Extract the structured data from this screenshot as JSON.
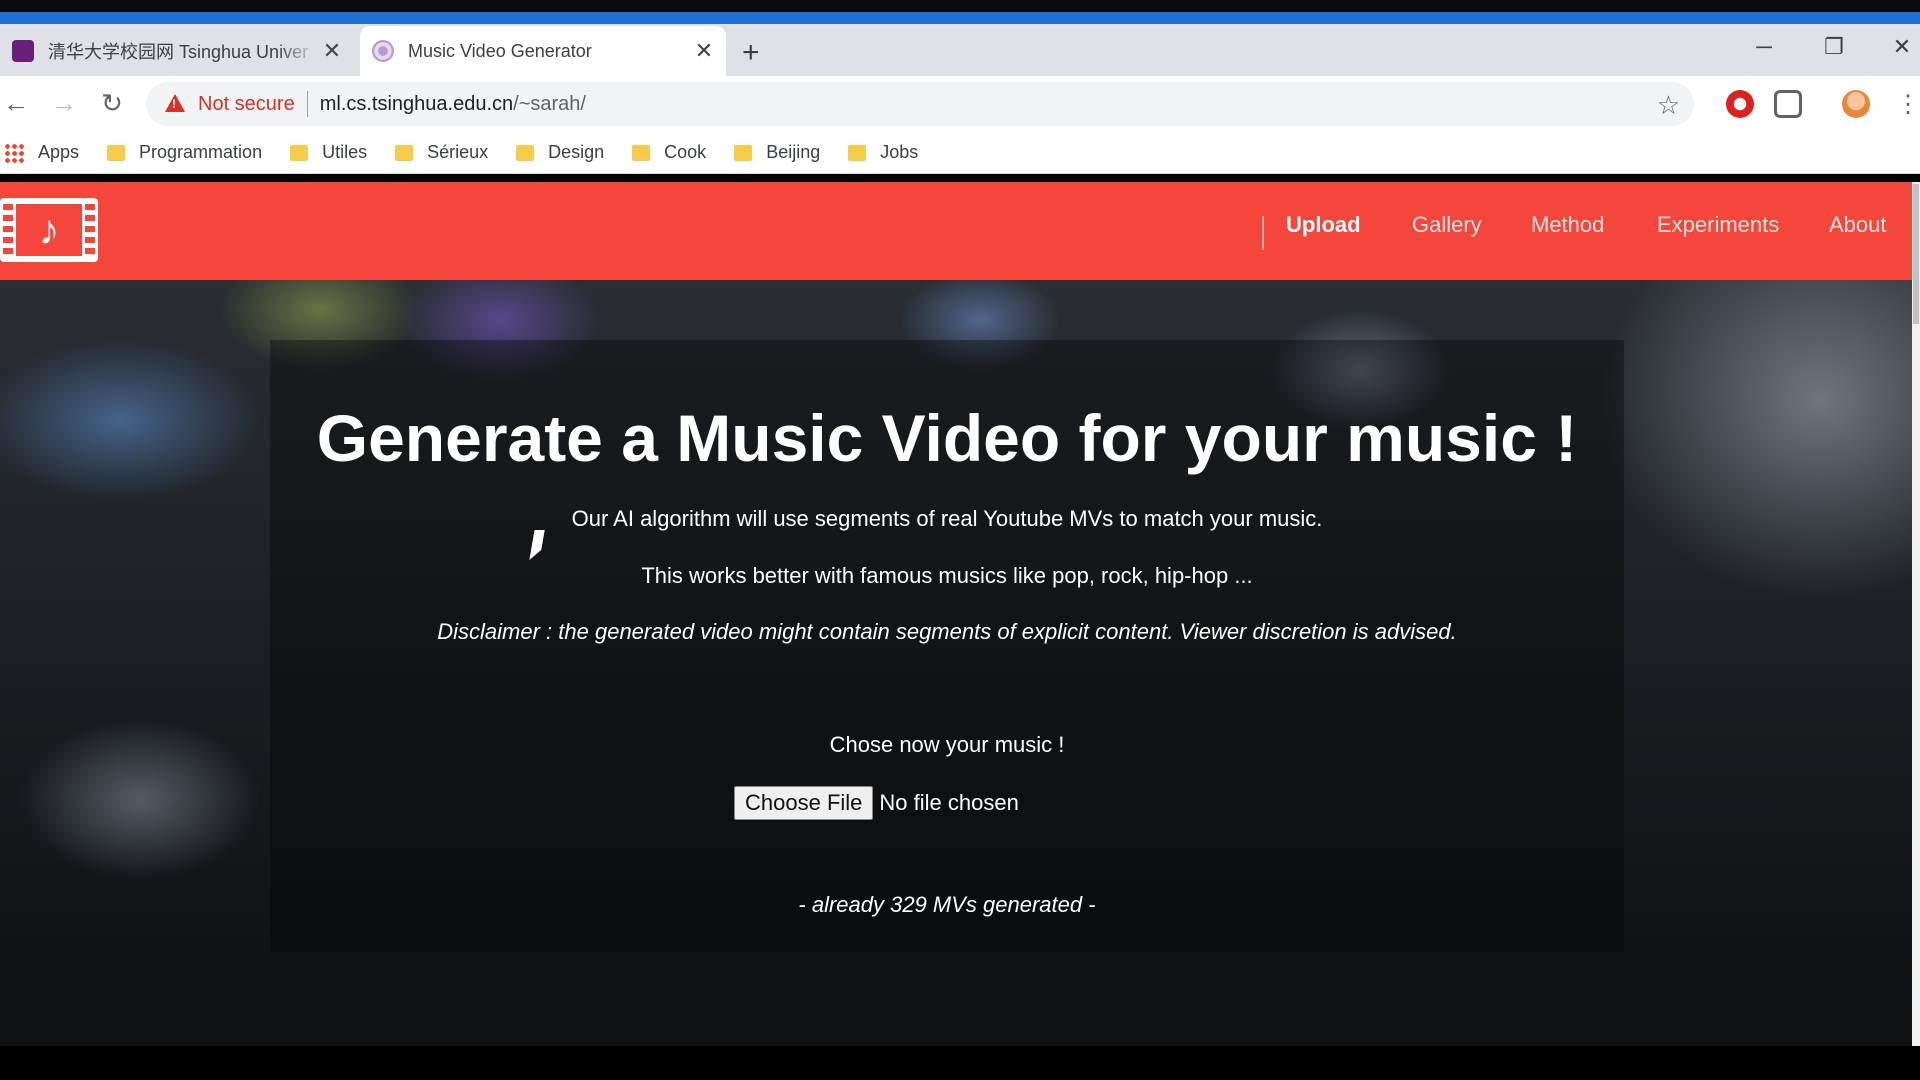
{
  "browser": {
    "tabs": [
      {
        "title": "清华大学校园网 Tsinghua Univer",
        "active": false
      },
      {
        "title": "Music Video Generator",
        "active": true
      }
    ],
    "new_tab_label": "+",
    "window_controls": {
      "minimize": "─",
      "restore": "❐",
      "close": "✕"
    },
    "tab_close": "✕",
    "nav": {
      "back": "←",
      "forward": "→",
      "reload": "↻"
    },
    "omnibox": {
      "security_label": "Not secure",
      "url_host": "ml.cs.tsinghua.edu.cn",
      "url_path": "/~sarah/"
    },
    "star": "☆",
    "menu": "⋮",
    "bookmarks": [
      "Apps",
      "Programmation",
      "Utiles",
      "Sérieux",
      "Design",
      "Cook",
      "Beijing",
      "Jobs"
    ]
  },
  "site": {
    "brand_color": "#f4463a",
    "logo_glyph": "♪",
    "nav": [
      "Upload",
      "Gallery",
      "Method",
      "Experiments",
      "About"
    ],
    "active_nav": "Upload",
    "hero": {
      "title": "Generate a Music Video for your music !",
      "subtitle_1": "Our AI algorithm will use segments of real Youtube MVs to match your music.",
      "subtitle_2": "This works better with famous musics like pop, rock, hip-hop ...",
      "disclaimer": "Disclaimer : the generated video might contain segments of explicit content. Viewer discretion is advised.",
      "choose_prompt": "Chose now your music !",
      "file_button": "Choose File",
      "file_status": "No file chosen",
      "mv_count": "- already 329 MVs generated -"
    }
  }
}
